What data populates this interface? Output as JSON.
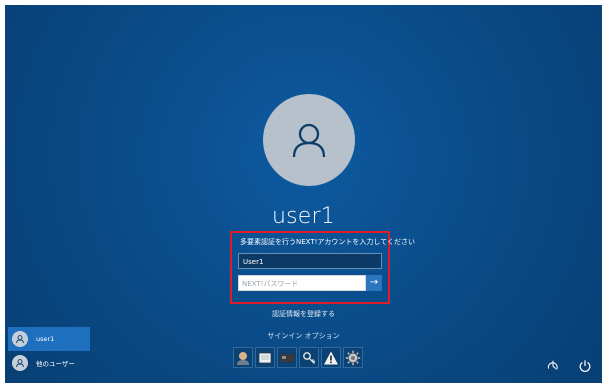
{
  "user": {
    "name": "user1"
  },
  "signin": {
    "prompt": "多要素認証を行うNEXT!アカウントを入力してください",
    "account_value": "User1",
    "password_placeholder": "NEXT!パスワード",
    "submit_symbol": "→"
  },
  "links": {
    "register": "認証情報を登録する"
  },
  "signin_options": {
    "label": "サインイン オプション",
    "icons": [
      "face-icon",
      "card-reader-icon",
      "smart-card-icon",
      "key-icon",
      "warning-icon",
      "settings-gear-icon"
    ]
  },
  "user_list": [
    {
      "label": "user1",
      "selected": true
    },
    {
      "label": "他のユーザー",
      "selected": false
    }
  ],
  "system_controls": [
    "ease-of-access-icon",
    "power-icon"
  ],
  "colors": {
    "background": "#0a4a86",
    "highlight_border": "#e11c2a",
    "selected_user": "#1f6fbf",
    "submit_button": "#2a76c0"
  }
}
